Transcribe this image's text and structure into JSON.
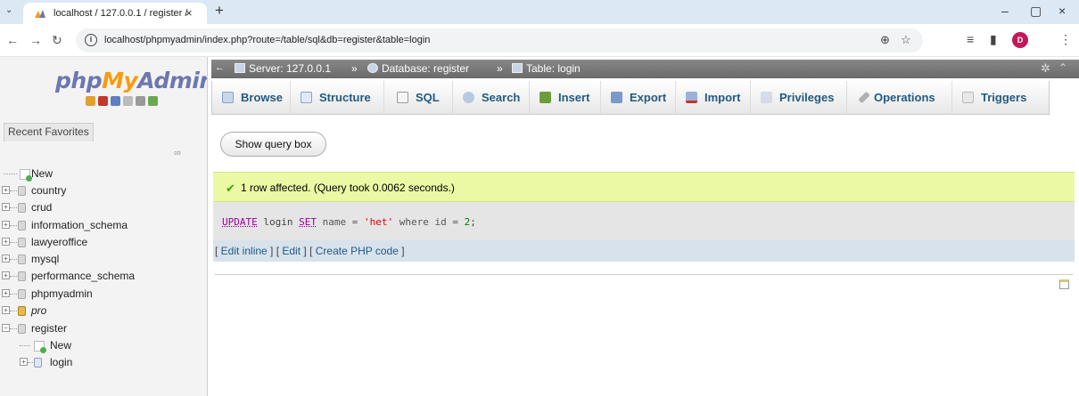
{
  "browser": {
    "tab_title": "localhost / 127.0.0.1 / register / ",
    "tab_close": "×",
    "new_tab": "+",
    "url": "localhost/phpmyadmin/index.php?route=/table/sql&db=register&table=login",
    "profile_initial": "D",
    "win_minimize": "–",
    "win_restore": "▢",
    "win_close": "×"
  },
  "sidebar": {
    "logo": {
      "php": "php",
      "my": "My",
      "admin": "Admin"
    },
    "tab_label": "Recent  Favorites",
    "tree": [
      {
        "label": "New",
        "kind": "new"
      },
      {
        "label": "country",
        "kind": "db"
      },
      {
        "label": "crud",
        "kind": "db"
      },
      {
        "label": "information_schema",
        "kind": "db"
      },
      {
        "label": "lawyeroffice",
        "kind": "db"
      },
      {
        "label": "mysql",
        "kind": "db"
      },
      {
        "label": "performance_schema",
        "kind": "db"
      },
      {
        "label": "phpmyadmin",
        "kind": "db"
      },
      {
        "label": "pro",
        "kind": "db-italic"
      },
      {
        "label": "register",
        "kind": "db-open"
      },
      {
        "label": "New",
        "kind": "new-child"
      },
      {
        "label": "login",
        "kind": "table-child"
      }
    ]
  },
  "breadcrumb": {
    "server": "Server: 127.0.0.1",
    "database": "Database: register",
    "table": "Table: login",
    "separator": "»"
  },
  "menu": {
    "browse": "Browse",
    "structure": "Structure",
    "sql": "SQL",
    "search": "Search",
    "insert": "Insert",
    "export": "Export",
    "import": "Import",
    "privileges": "Privileges",
    "operations": "Operations",
    "triggers": "Triggers"
  },
  "main": {
    "show_query_box": "Show query box",
    "success_message": "1 row affected. (Query took 0.0062 seconds.)",
    "sql": {
      "kw_update": "UPDATE",
      "table": " login ",
      "kw_set": "SET",
      "assign": " name = ",
      "value": "'het'",
      "where": " where id = ",
      "id": "2",
      "end": ";"
    },
    "tools": {
      "edit_inline": "Edit inline",
      "edit": "Edit",
      "create_php": "Create PHP code"
    }
  },
  "colors": {
    "success_bg": "#ebf8a4",
    "link": "#235a81",
    "logo_blue": "#6c78af",
    "logo_orange": "#f89c0e"
  }
}
